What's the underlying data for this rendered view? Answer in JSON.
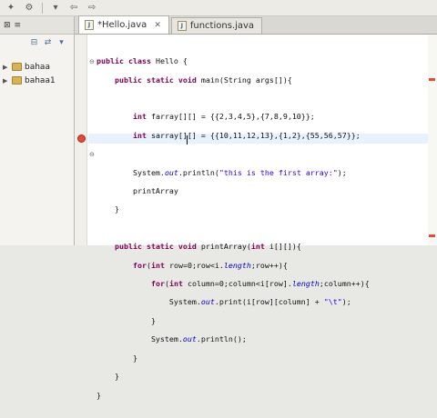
{
  "toolbar": {
    "icons": [
      "new-wizard-icon",
      "run-config-icon",
      "dropdown-icon",
      "back-icon",
      "forward-icon"
    ]
  },
  "left_panel": {
    "tabs": [
      "⊠",
      "≡"
    ],
    "projects": [
      {
        "name": "bahaa"
      },
      {
        "name": "bahaa1"
      }
    ]
  },
  "editor": {
    "tabs": [
      {
        "label": "*Hello.java",
        "active": true
      },
      {
        "label": "functions.java",
        "active": false
      }
    ],
    "code_lines": [
      "public class Hello {",
      "    public static void main(String args[]){",
      "",
      "        int farray[][] = {{2,3,4,5},{7,8,9,10}};",
      "        int sarray[][] = {{10,11,12,13},{1,2},{55,56,57}};",
      "",
      "        System.out.println(\"this is the first array:\");",
      "        printArray",
      "    }",
      "",
      "    public static void printArray(int i[][]){",
      "        for(int row=0;row<i.length;row++){",
      "            for(int column=0;column<i[row].length;column++){",
      "                System.out.print(i[row][column] + \"\\t\");",
      "            }",
      "            System.out.println();",
      "        }",
      "    }",
      "}"
    ]
  },
  "colors": {
    "keyword": "#7f0055",
    "string": "#2a00ff",
    "field": "#0000c0",
    "error": "#e04b3b"
  }
}
